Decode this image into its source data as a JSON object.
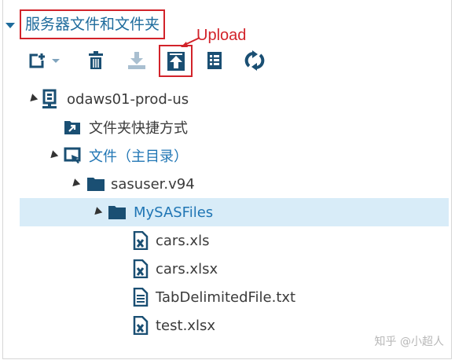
{
  "panel": {
    "title": "服务器文件和文件夹",
    "annotation": "Upload"
  },
  "toolbar": {
    "buttons": [
      {
        "icon": "new-dropdown-icon",
        "tooltip": ""
      },
      {
        "icon": "delete-icon",
        "tooltip": ""
      },
      {
        "icon": "download-icon",
        "tooltip": ""
      },
      {
        "icon": "upload-icon",
        "tooltip": ""
      },
      {
        "icon": "properties-icon",
        "tooltip": ""
      },
      {
        "icon": "refresh-icon",
        "tooltip": ""
      }
    ]
  },
  "tree": {
    "nodes": [
      {
        "label": "odaws01-prod-us",
        "icon": "server-icon",
        "level": 0,
        "expanded": true
      },
      {
        "label": "文件夹快捷方式",
        "icon": "folder-shortcut-icon",
        "level": 1,
        "expanded": false
      },
      {
        "label": "文件（主目录）",
        "icon": "home-folder-icon",
        "level": 1,
        "expanded": true
      },
      {
        "label": "sasuser.v94",
        "icon": "folder-icon",
        "level": 2,
        "expanded": true
      },
      {
        "label": "MySASFiles",
        "icon": "folder-icon",
        "level": 3,
        "expanded": true,
        "selected": true
      },
      {
        "label": "cars.xls",
        "icon": "excel-file-icon",
        "level": 4
      },
      {
        "label": "cars.xlsx",
        "icon": "excel-file-icon",
        "level": 4
      },
      {
        "label": "TabDelimitedFile.txt",
        "icon": "text-file-icon",
        "level": 4
      },
      {
        "label": "test.xlsx",
        "icon": "excel-file-icon",
        "level": 4
      }
    ]
  },
  "watermark": "知乎 @小超人",
  "colors": {
    "accent_blue": "#1e6b9c",
    "highlight": "#d2232a",
    "selection_bg": "#d8ecf8",
    "icon_dark": "#1a4f73"
  }
}
